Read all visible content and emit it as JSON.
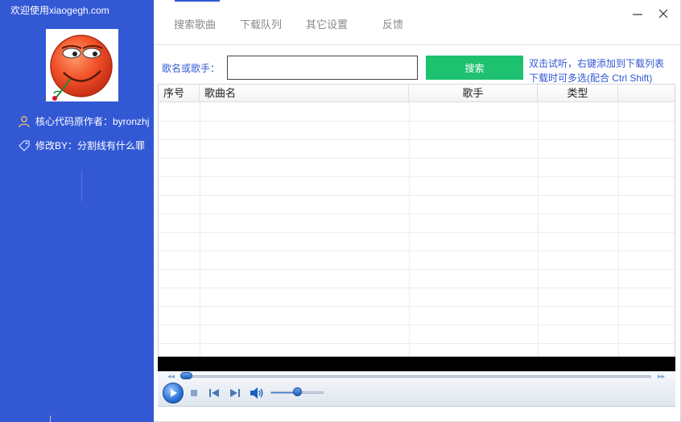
{
  "sidebar": {
    "welcome": "欢迎使用xiaogegh.com",
    "author_line": "核心代码原作者：byronzhj",
    "modified_line": "修改BY：分割线有什么罪",
    "bg_color": "#3358d4"
  },
  "tabs": [
    {
      "label": "搜索歌曲",
      "active": true
    },
    {
      "label": "下载队列",
      "active": false
    },
    {
      "label": "其它设置",
      "active": false
    },
    {
      "label": "反馈",
      "active": false
    }
  ],
  "window": {
    "minimize_icon": "minimize-icon",
    "close_icon": "close-icon"
  },
  "search": {
    "label": "歌名或歌手：",
    "value": "",
    "button_label": "搜索",
    "button_color": "#1dc16f",
    "hint_line1": "双击试听，右键添加到下载列表",
    "hint_line2": "下载时可多选(配合 Ctrl Shift)"
  },
  "table": {
    "columns": [
      "序号",
      "歌曲名",
      "歌手",
      "类型",
      ""
    ],
    "rows": []
  },
  "player": {
    "progress": 0.0,
    "volume": 0.5,
    "accent_color": "#2a6fd6"
  }
}
